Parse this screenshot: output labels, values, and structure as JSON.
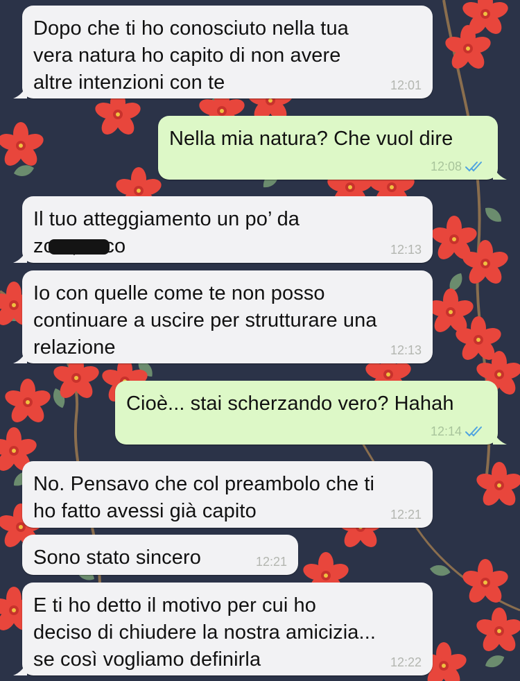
{
  "theme": {
    "incoming_bubble": "#f2f2f4",
    "outgoing_bubble": "#ddf8c7",
    "read_ticks_color": "#4fa3e0",
    "wallpaper_base": "#2b3348",
    "flower_color": "#e8463c",
    "leaf_color": "#6b8c6e"
  },
  "messages": [
    {
      "direction": "in",
      "text": "Dopo che ti ho conosciuto nella tua\nvera natura ho capito di non avere\naltre intenzioni con te",
      "time": "12:01"
    },
    {
      "direction": "out",
      "text": "Nella mia natura? Che vuol dire",
      "time": "12:08",
      "status": "read"
    },
    {
      "direction": "in",
      "text": "Il tuo atteggiamento un po’ da\nzo        a, ecco",
      "time": "12:13",
      "redacted": true
    },
    {
      "direction": "in",
      "text": "Io con quelle come te non posso\ncontinuare a uscire per strutturare una\nrelazione",
      "time": "12:13"
    },
    {
      "direction": "out",
      "text": "Cioè... stai scherzando vero? Hahah",
      "time": "12:14",
      "status": "read"
    },
    {
      "direction": "in",
      "text": "No. Pensavo che col preambolo che ti\nho fatto avessi già capito",
      "time": "12:21"
    },
    {
      "direction": "in",
      "text": "Sono stato sincero",
      "time": "12:21"
    },
    {
      "direction": "in",
      "text": "E ti ho detto il motivo per cui ho\ndeciso di chiudere la nostra amicizia...\nse così vogliamo definirla",
      "time": "12:22"
    }
  ]
}
